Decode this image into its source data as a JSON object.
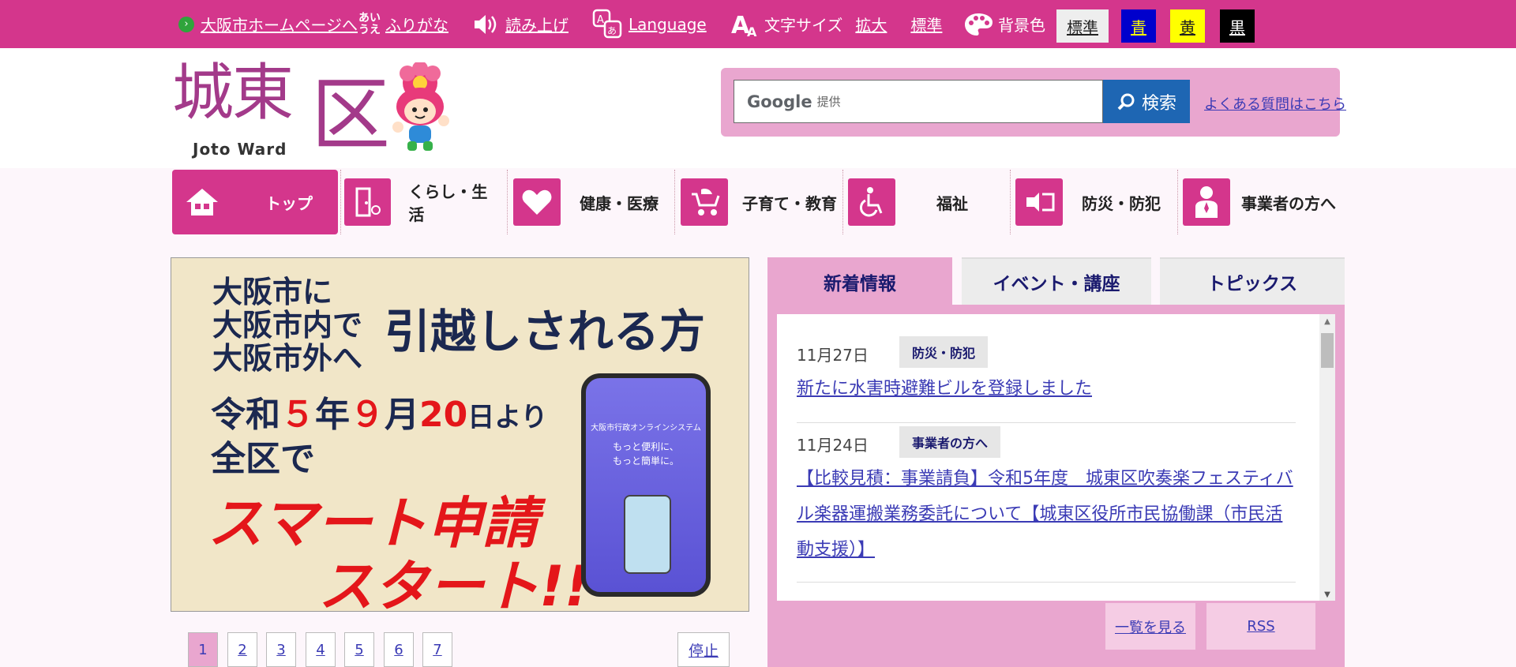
{
  "topbar": {
    "home_link": "大阪市ホームページへ",
    "furigana_icon": "あい\nうえ",
    "furigana": "ふりがな",
    "read_aloud": "読み上げ",
    "language": "Language",
    "font_size_label": "文字サイズ",
    "font_enlarge": "拡大",
    "font_standard": "標準",
    "bg_label": "背景色",
    "bg_options": [
      {
        "label": "標準",
        "bg": "#eeeeee",
        "fg": "#222222"
      },
      {
        "label": "青",
        "bg": "#0000cc",
        "fg": "#ffff00"
      },
      {
        "label": "黄",
        "bg": "#ffff00",
        "fg": "#222222"
      },
      {
        "label": "黒",
        "bg": "#000000",
        "fg": "#ffffff"
      }
    ]
  },
  "header": {
    "logo_kanji": "城東",
    "logo_ku": "区",
    "logo_sub": "Joto Ward",
    "search_placeholder_brand": "Google",
    "search_placeholder": "提供",
    "search_button": "検索",
    "faq_link": "よくある質問はこちら"
  },
  "gnav": {
    "items": [
      {
        "label": "トップ",
        "icon": "house-icon"
      },
      {
        "label": "くらし・生活",
        "icon": "door-icon"
      },
      {
        "label": "健康・医療",
        "icon": "heart-icon"
      },
      {
        "label": "子育て・教育",
        "icon": "stroller-icon"
      },
      {
        "label": "福祉",
        "icon": "wheelchair-icon"
      },
      {
        "label": "防災・防犯",
        "icon": "flashlight-icon"
      },
      {
        "label": "事業者の方へ",
        "icon": "businessperson-icon"
      }
    ]
  },
  "banner": {
    "line1": "大阪市に",
    "line2": "大阪市内で",
    "line3": "大阪市外へ",
    "headline": "引越しされる方",
    "date_pre": "令和",
    "date_5": "５",
    "date_nen": "年",
    "date_9": "９",
    "date_tsuki": "月",
    "date_20": "20",
    "date_post": "日より",
    "line_zenku": "全区で",
    "smart": "スマート申請",
    "start": "スタート!!",
    "phone_title": "大阪市行政オンラインシステム",
    "phone_l1": "もっと便利に、",
    "phone_l2": "もっと簡単に。"
  },
  "pager": {
    "pages": [
      "1",
      "2",
      "3",
      "4",
      "5",
      "6",
      "7"
    ],
    "stop": "停止"
  },
  "news": {
    "tabs": [
      "新着情報",
      "イベント・講座",
      "トピックス"
    ],
    "items": [
      {
        "date": "11月27日",
        "category": "防災・防犯",
        "title": "新たに水害時避難ビルを登録しました"
      },
      {
        "date": "11月24日",
        "category": "事業者の方へ",
        "title": "【比較見積：事業請負】令和5年度　城東区吹奏楽フェスティバル楽器運搬業務委託について【城東区役所市民協働課（市民活動支援）】"
      }
    ],
    "list_button": "一覧を見る",
    "rss_button": "RSS"
  },
  "colors": {
    "brand": "#d4368c",
    "pink_light": "#e9a6cf",
    "link": "#3b3bb5"
  }
}
